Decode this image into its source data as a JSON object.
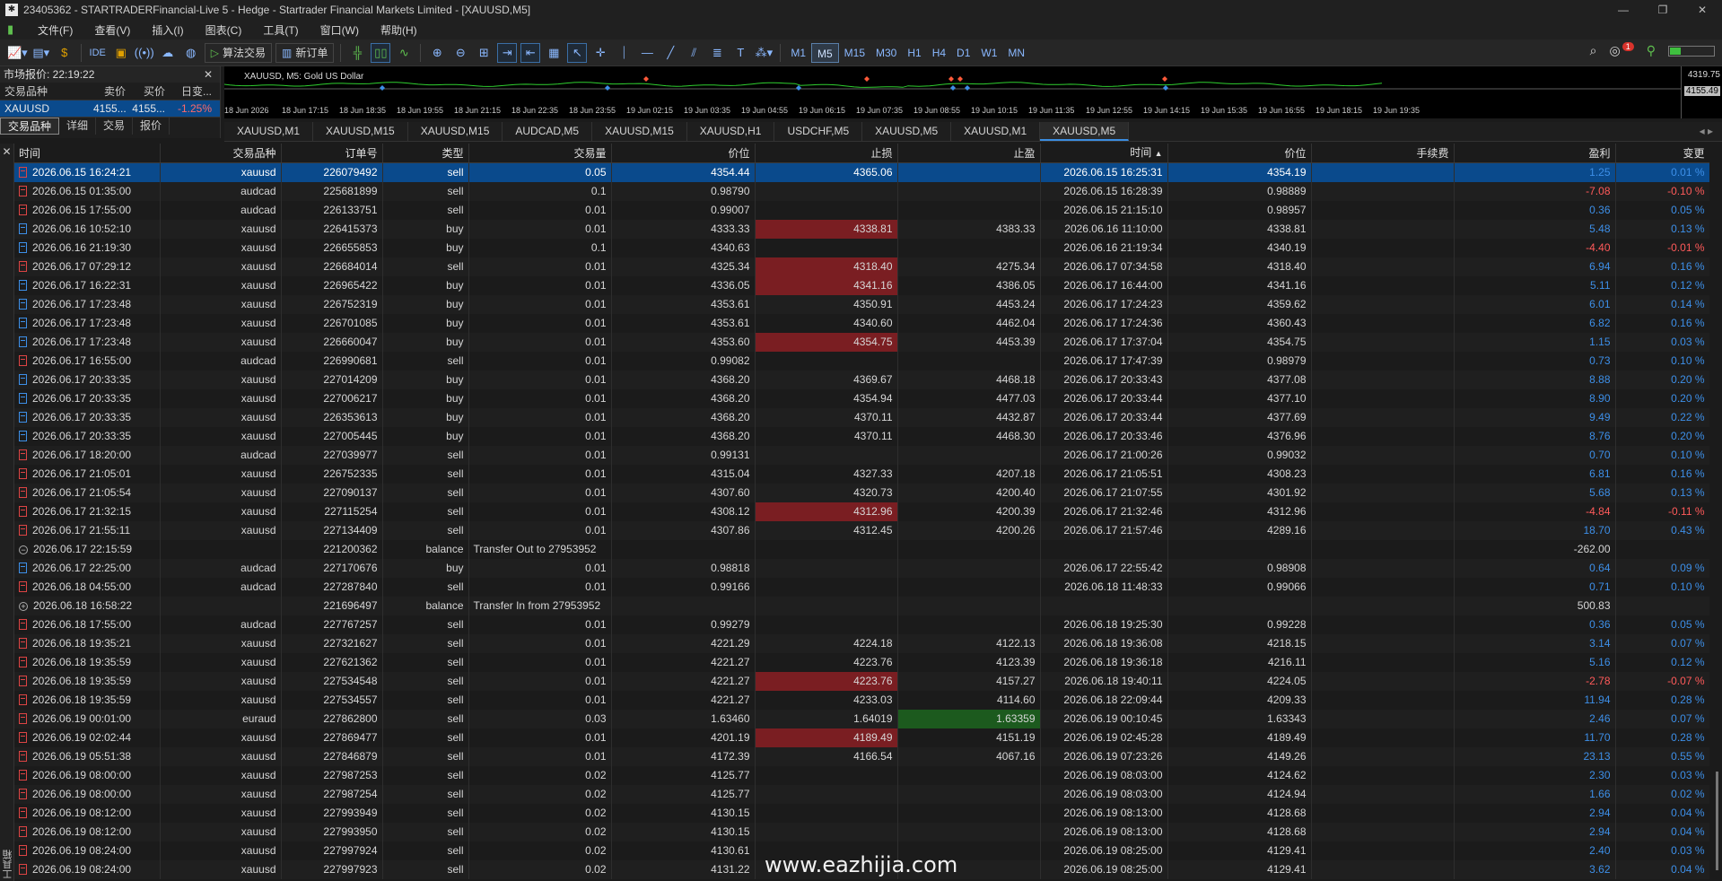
{
  "window": {
    "title": "23405362 - STARTRADERFinancial-Live 5 - Hedge - Startrader Financial Markets Limited - [XAUUSD,M5]",
    "controls": [
      "—",
      "❐",
      "✕"
    ]
  },
  "menu": [
    "文件(F)",
    "查看(V)",
    "插入(I)",
    "图表(C)",
    "工具(T)",
    "窗口(W)",
    "帮助(H)"
  ],
  "toolbar": {
    "ide_label": "IDE",
    "algo_label": "算法交易",
    "new_order_label": "新订单",
    "timeframes": [
      "M1",
      "M5",
      "M15",
      "M30",
      "H1",
      "H4",
      "D1",
      "W1",
      "MN"
    ],
    "active_timeframe": "M5",
    "notification_count": "1"
  },
  "market_watch": {
    "title": "市场报价: 22:19:22",
    "close": "✕",
    "headers": [
      "交易品种",
      "卖价",
      "买价",
      "日变..."
    ],
    "row": {
      "symbol": "XAUUSD",
      "bid": "4155...",
      "ask": "4155...",
      "change": "-1.25%"
    },
    "tabs": [
      "交易品种",
      "详细",
      "交易",
      "报价"
    ],
    "active_tab": "交易品种"
  },
  "chart": {
    "label": "XAUUSD, M5:  Gold US Dollar",
    "price_top": "4319.75",
    "price_current": "4155.49",
    "time_ticks": [
      "18 Jun 2026",
      "18 Jun 17:15",
      "18 Jun 18:35",
      "18 Jun 19:55",
      "18 Jun 21:15",
      "18 Jun 22:35",
      "18 Jun 23:55",
      "19 Jun 02:15",
      "19 Jun 03:35",
      "19 Jun 04:55",
      "19 Jun 06:15",
      "19 Jun 07:35",
      "19 Jun 08:55",
      "19 Jun 10:15",
      "19 Jun 11:35",
      "19 Jun 12:55",
      "19 Jun 14:15",
      "19 Jun 15:35",
      "19 Jun 16:55",
      "19 Jun 18:15",
      "19 Jun 19:35"
    ]
  },
  "chart_tabs": [
    "XAUUSD,M1",
    "XAUUSD,M15",
    "XAUUSD,M15",
    "AUDCAD,M5",
    "XAUUSD,M15",
    "XAUUSD,H1",
    "USDCHF,M5",
    "XAUUSD,M5",
    "XAUUSD,M1",
    "XAUUSD,M5"
  ],
  "active_chart_tab": 9,
  "chart_tab_arrows": "◂ ▸",
  "terminal": {
    "side_label": "工具箱",
    "close": "✕",
    "columns": [
      "时间",
      "交易品种",
      "订单号",
      "类型",
      "交易量",
      "价位",
      "止损",
      "止盈",
      "时间",
      "价位",
      "手续费",
      "盈利",
      "变更"
    ],
    "sort_indicator": "▲",
    "rows": [
      {
        "t": "2026.06.15 16:24:21",
        "s": "xauusd",
        "o": "226079492",
        "ty": "sell",
        "v": "0.05",
        "p": "4354.44",
        "sl": "4365.06",
        "tp": "",
        "t2": "2026.06.15 16:25:31",
        "p2": "4354.19",
        "c": "",
        "pr": "1.25",
        "ch": "0.01 %",
        "sel": true
      },
      {
        "t": "2026.06.15 01:35:00",
        "s": "audcad",
        "o": "225681899",
        "ty": "sell",
        "v": "0.1",
        "p": "0.98790",
        "sl": "",
        "tp": "",
        "t2": "2026.06.15 16:28:39",
        "p2": "0.98889",
        "c": "",
        "pr": "-7.08",
        "ch": "-0.10 %"
      },
      {
        "t": "2026.06.15 17:55:00",
        "s": "audcad",
        "o": "226133751",
        "ty": "sell",
        "v": "0.01",
        "p": "0.99007",
        "sl": "",
        "tp": "",
        "t2": "2026.06.15 21:15:10",
        "p2": "0.98957",
        "c": "",
        "pr": "0.36",
        "ch": "0.05 %"
      },
      {
        "t": "2026.06.16 10:52:10",
        "s": "xauusd",
        "o": "226415373",
        "ty": "buy",
        "v": "0.01",
        "p": "4333.33",
        "sl": "4338.81",
        "tp": "4383.33",
        "t2": "2026.06.16 11:10:00",
        "p2": "4338.81",
        "c": "",
        "pr": "5.48",
        "ch": "0.13 %",
        "slhl": "red"
      },
      {
        "t": "2026.06.16 21:19:30",
        "s": "xauusd",
        "o": "226655853",
        "ty": "buy",
        "v": "0.1",
        "p": "4340.63",
        "sl": "",
        "tp": "",
        "t2": "2026.06.16 21:19:34",
        "p2": "4340.19",
        "c": "",
        "pr": "-4.40",
        "ch": "-0.01 %"
      },
      {
        "t": "2026.06.17 07:29:12",
        "s": "xauusd",
        "o": "226684014",
        "ty": "sell",
        "v": "0.01",
        "p": "4325.34",
        "sl": "4318.40",
        "tp": "4275.34",
        "t2": "2026.06.17 07:34:58",
        "p2": "4318.40",
        "c": "",
        "pr": "6.94",
        "ch": "0.16 %",
        "slhl": "red"
      },
      {
        "t": "2026.06.17 16:22:31",
        "s": "xauusd",
        "o": "226965422",
        "ty": "buy",
        "v": "0.01",
        "p": "4336.05",
        "sl": "4341.16",
        "tp": "4386.05",
        "t2": "2026.06.17 16:44:00",
        "p2": "4341.16",
        "c": "",
        "pr": "5.11",
        "ch": "0.12 %",
        "slhl": "red"
      },
      {
        "t": "2026.06.17 17:23:48",
        "s": "xauusd",
        "o": "226752319",
        "ty": "buy",
        "v": "0.01",
        "p": "4353.61",
        "sl": "4350.91",
        "tp": "4453.24",
        "t2": "2026.06.17 17:24:23",
        "p2": "4359.62",
        "c": "",
        "pr": "6.01",
        "ch": "0.14 %"
      },
      {
        "t": "2026.06.17 17:23:48",
        "s": "xauusd",
        "o": "226701085",
        "ty": "buy",
        "v": "0.01",
        "p": "4353.61",
        "sl": "4340.60",
        "tp": "4462.04",
        "t2": "2026.06.17 17:24:36",
        "p2": "4360.43",
        "c": "",
        "pr": "6.82",
        "ch": "0.16 %"
      },
      {
        "t": "2026.06.17 17:23:48",
        "s": "xauusd",
        "o": "226660047",
        "ty": "buy",
        "v": "0.01",
        "p": "4353.60",
        "sl": "4354.75",
        "tp": "4453.39",
        "t2": "2026.06.17 17:37:04",
        "p2": "4354.75",
        "c": "",
        "pr": "1.15",
        "ch": "0.03 %",
        "slhl": "red"
      },
      {
        "t": "2026.06.17 16:55:00",
        "s": "audcad",
        "o": "226990681",
        "ty": "sell",
        "v": "0.01",
        "p": "0.99082",
        "sl": "",
        "tp": "",
        "t2": "2026.06.17 17:47:39",
        "p2": "0.98979",
        "c": "",
        "pr": "0.73",
        "ch": "0.10 %"
      },
      {
        "t": "2026.06.17 20:33:35",
        "s": "xauusd",
        "o": "227014209",
        "ty": "buy",
        "v": "0.01",
        "p": "4368.20",
        "sl": "4369.67",
        "tp": "4468.18",
        "t2": "2026.06.17 20:33:43",
        "p2": "4377.08",
        "c": "",
        "pr": "8.88",
        "ch": "0.20 %"
      },
      {
        "t": "2026.06.17 20:33:35",
        "s": "xauusd",
        "o": "227006217",
        "ty": "buy",
        "v": "0.01",
        "p": "4368.20",
        "sl": "4354.94",
        "tp": "4477.03",
        "t2": "2026.06.17 20:33:44",
        "p2": "4377.10",
        "c": "",
        "pr": "8.90",
        "ch": "0.20 %"
      },
      {
        "t": "2026.06.17 20:33:35",
        "s": "xauusd",
        "o": "226353613",
        "ty": "buy",
        "v": "0.01",
        "p": "4368.20",
        "sl": "4370.11",
        "tp": "4432.87",
        "t2": "2026.06.17 20:33:44",
        "p2": "4377.69",
        "c": "",
        "pr": "9.49",
        "ch": "0.22 %"
      },
      {
        "t": "2026.06.17 20:33:35",
        "s": "xauusd",
        "o": "227005445",
        "ty": "buy",
        "v": "0.01",
        "p": "4368.20",
        "sl": "4370.11",
        "tp": "4468.30",
        "t2": "2026.06.17 20:33:46",
        "p2": "4376.96",
        "c": "",
        "pr": "8.76",
        "ch": "0.20 %"
      },
      {
        "t": "2026.06.17 18:20:00",
        "s": "audcad",
        "o": "227039977",
        "ty": "sell",
        "v": "0.01",
        "p": "0.99131",
        "sl": "",
        "tp": "",
        "t2": "2026.06.17 21:00:26",
        "p2": "0.99032",
        "c": "",
        "pr": "0.70",
        "ch": "0.10 %"
      },
      {
        "t": "2026.06.17 21:05:01",
        "s": "xauusd",
        "o": "226752335",
        "ty": "sell",
        "v": "0.01",
        "p": "4315.04",
        "sl": "4327.33",
        "tp": "4207.18",
        "t2": "2026.06.17 21:05:51",
        "p2": "4308.23",
        "c": "",
        "pr": "6.81",
        "ch": "0.16 %"
      },
      {
        "t": "2026.06.17 21:05:54",
        "s": "xauusd",
        "o": "227090137",
        "ty": "sell",
        "v": "0.01",
        "p": "4307.60",
        "sl": "4320.73",
        "tp": "4200.40",
        "t2": "2026.06.17 21:07:55",
        "p2": "4301.92",
        "c": "",
        "pr": "5.68",
        "ch": "0.13 %"
      },
      {
        "t": "2026.06.17 21:32:15",
        "s": "xauusd",
        "o": "227115254",
        "ty": "sell",
        "v": "0.01",
        "p": "4308.12",
        "sl": "4312.96",
        "tp": "4200.39",
        "t2": "2026.06.17 21:32:46",
        "p2": "4312.96",
        "c": "",
        "pr": "-4.84",
        "ch": "-0.11 %",
        "slhl": "red"
      },
      {
        "t": "2026.06.17 21:55:11",
        "s": "xauusd",
        "o": "227134409",
        "ty": "sell",
        "v": "0.01",
        "p": "4307.86",
        "sl": "4312.45",
        "tp": "4200.26",
        "t2": "2026.06.17 21:57:46",
        "p2": "4289.16",
        "c": "",
        "pr": "18.70",
        "ch": "0.43 %"
      },
      {
        "t": "2026.06.17 22:15:59",
        "s": "",
        "o": "221200362",
        "ty": "balance",
        "v": "Transfer Out to 27953952",
        "p": "",
        "sl": "",
        "tp": "",
        "t2": "",
        "p2": "",
        "c": "",
        "pr": "-262.00",
        "ch": "",
        "balance": true,
        "bal_icon": "−"
      },
      {
        "t": "2026.06.17 22:25:00",
        "s": "audcad",
        "o": "227170676",
        "ty": "buy",
        "v": "0.01",
        "p": "0.98818",
        "sl": "",
        "tp": "",
        "t2": "2026.06.17 22:55:42",
        "p2": "0.98908",
        "c": "",
        "pr": "0.64",
        "ch": "0.09 %"
      },
      {
        "t": "2026.06.18 04:55:00",
        "s": "audcad",
        "o": "227287840",
        "ty": "sell",
        "v": "0.01",
        "p": "0.99166",
        "sl": "",
        "tp": "",
        "t2": "2026.06.18 11:48:33",
        "p2": "0.99066",
        "c": "",
        "pr": "0.71",
        "ch": "0.10 %"
      },
      {
        "t": "2026.06.18 16:58:22",
        "s": "",
        "o": "221696497",
        "ty": "balance",
        "v": "Transfer In from 27953952",
        "p": "",
        "sl": "",
        "tp": "",
        "t2": "",
        "p2": "",
        "c": "",
        "pr": "500.83",
        "ch": "",
        "balance": true,
        "bal_icon": "+"
      },
      {
        "t": "2026.06.18 17:55:00",
        "s": "audcad",
        "o": "227767257",
        "ty": "sell",
        "v": "0.01",
        "p": "0.99279",
        "sl": "",
        "tp": "",
        "t2": "2026.06.18 19:25:30",
        "p2": "0.99228",
        "c": "",
        "pr": "0.36",
        "ch": "0.05 %"
      },
      {
        "t": "2026.06.18 19:35:21",
        "s": "xauusd",
        "o": "227321627",
        "ty": "sell",
        "v": "0.01",
        "p": "4221.29",
        "sl": "4224.18",
        "tp": "4122.13",
        "t2": "2026.06.18 19:36:08",
        "p2": "4218.15",
        "c": "",
        "pr": "3.14",
        "ch": "0.07 %"
      },
      {
        "t": "2026.06.18 19:35:59",
        "s": "xauusd",
        "o": "227621362",
        "ty": "sell",
        "v": "0.01",
        "p": "4221.27",
        "sl": "4223.76",
        "tp": "4123.39",
        "t2": "2026.06.18 19:36:18",
        "p2": "4216.11",
        "c": "",
        "pr": "5.16",
        "ch": "0.12 %"
      },
      {
        "t": "2026.06.18 19:35:59",
        "s": "xauusd",
        "o": "227534548",
        "ty": "sell",
        "v": "0.01",
        "p": "4221.27",
        "sl": "4223.76",
        "tp": "4157.27",
        "t2": "2026.06.18 19:40:11",
        "p2": "4224.05",
        "c": "",
        "pr": "-2.78",
        "ch": "-0.07 %",
        "slhl": "red"
      },
      {
        "t": "2026.06.18 19:35:59",
        "s": "xauusd",
        "o": "227534557",
        "ty": "sell",
        "v": "0.01",
        "p": "4221.27",
        "sl": "4233.03",
        "tp": "4114.60",
        "t2": "2026.06.18 22:09:44",
        "p2": "4209.33",
        "c": "",
        "pr": "11.94",
        "ch": "0.28 %"
      },
      {
        "t": "2026.06.19 00:01:00",
        "s": "euraud",
        "o": "227862800",
        "ty": "sell",
        "v": "0.03",
        "p": "1.63460",
        "sl": "1.64019",
        "tp": "1.63359",
        "t2": "2026.06.19 00:10:45",
        "p2": "1.63343",
        "c": "",
        "pr": "2.46",
        "ch": "0.07 %",
        "tphl": "green"
      },
      {
        "t": "2026.06.19 02:02:44",
        "s": "xauusd",
        "o": "227869477",
        "ty": "sell",
        "v": "0.01",
        "p": "4201.19",
        "sl": "4189.49",
        "tp": "4151.19",
        "t2": "2026.06.19 02:45:28",
        "p2": "4189.49",
        "c": "",
        "pr": "11.70",
        "ch": "0.28 %",
        "slhl": "red"
      },
      {
        "t": "2026.06.19 05:51:38",
        "s": "xauusd",
        "o": "227846879",
        "ty": "sell",
        "v": "0.01",
        "p": "4172.39",
        "sl": "4166.54",
        "tp": "4067.16",
        "t2": "2026.06.19 07:23:26",
        "p2": "4149.26",
        "c": "",
        "pr": "23.13",
        "ch": "0.55 %"
      },
      {
        "t": "2026.06.19 08:00:00",
        "s": "xauusd",
        "o": "227987253",
        "ty": "sell",
        "v": "0.02",
        "p": "4125.77",
        "sl": "",
        "tp": "",
        "t2": "2026.06.19 08:03:00",
        "p2": "4124.62",
        "c": "",
        "pr": "2.30",
        "ch": "0.03 %"
      },
      {
        "t": "2026.06.19 08:00:00",
        "s": "xauusd",
        "o": "227987254",
        "ty": "sell",
        "v": "0.02",
        "p": "4125.77",
        "sl": "",
        "tp": "",
        "t2": "2026.06.19 08:03:00",
        "p2": "4124.94",
        "c": "",
        "pr": "1.66",
        "ch": "0.02 %"
      },
      {
        "t": "2026.06.19 08:12:00",
        "s": "xauusd",
        "o": "227993949",
        "ty": "sell",
        "v": "0.02",
        "p": "4130.15",
        "sl": "",
        "tp": "",
        "t2": "2026.06.19 08:13:00",
        "p2": "4128.68",
        "c": "",
        "pr": "2.94",
        "ch": "0.04 %"
      },
      {
        "t": "2026.06.19 08:12:00",
        "s": "xauusd",
        "o": "227993950",
        "ty": "sell",
        "v": "0.02",
        "p": "4130.15",
        "sl": "",
        "tp": "",
        "t2": "2026.06.19 08:13:00",
        "p2": "4128.68",
        "c": "",
        "pr": "2.94",
        "ch": "0.04 %"
      },
      {
        "t": "2026.06.19 08:24:00",
        "s": "xauusd",
        "o": "227997924",
        "ty": "sell",
        "v": "0.02",
        "p": "4130.61",
        "sl": "",
        "tp": "",
        "t2": "2026.06.19 08:25:00",
        "p2": "4129.41",
        "c": "",
        "pr": "2.40",
        "ch": "0.03 %"
      },
      {
        "t": "2026.06.19 08:24:00",
        "s": "xauusd",
        "o": "227997923",
        "ty": "sell",
        "v": "0.02",
        "p": "4131.22",
        "sl": "",
        "tp": "",
        "t2": "2026.06.19 08:25:00",
        "p2": "4129.41",
        "c": "",
        "pr": "3.62",
        "ch": "0.04 %"
      }
    ]
  },
  "watermark": "www.eazhijia.com",
  "colors": {
    "selection": "#0a4a8c",
    "profit": "#3d8fe8",
    "loss": "#ff5a5a",
    "sl_hit": "#7a1e22",
    "tp_hit": "#1c5a1e"
  }
}
